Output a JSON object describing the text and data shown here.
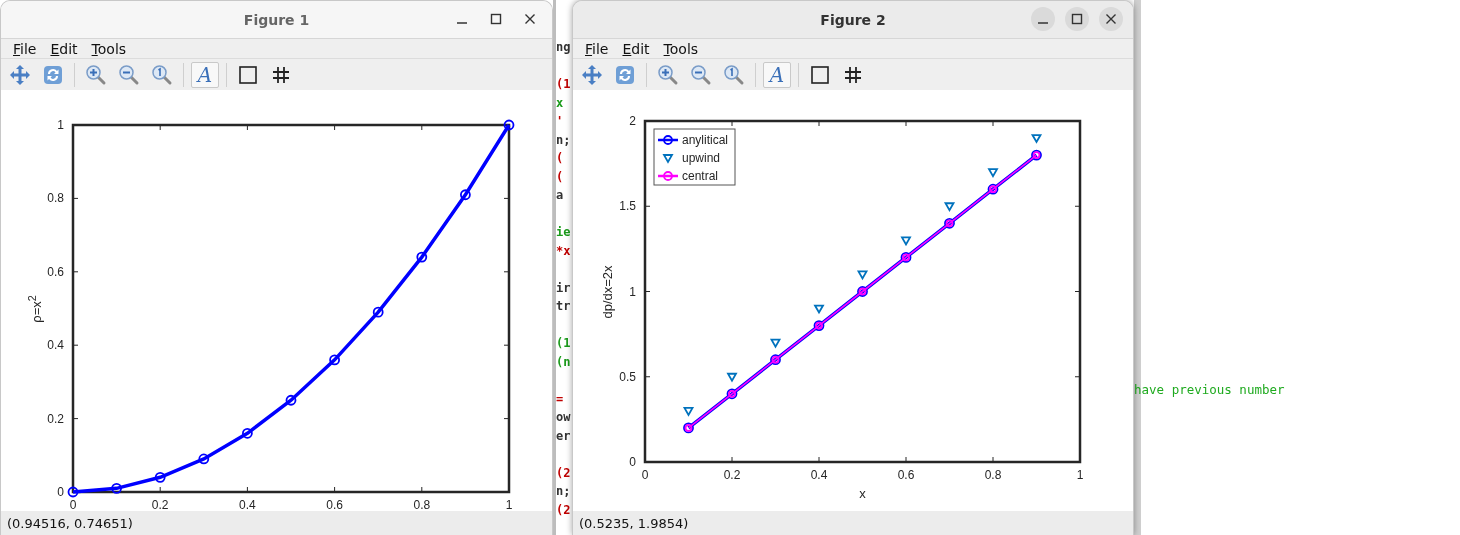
{
  "editor": {
    "strip_lines": [
      {
        "kind": "code",
        "text": "ng",
        "color": "#333333"
      },
      {
        "kind": "blank"
      },
      {
        "kind": "code",
        "text": "(1",
        "color": "#c00000"
      },
      {
        "kind": "code",
        "text": "x",
        "color": "#1a9a1a"
      },
      {
        "kind": "code",
        "text": "'",
        "color": "#c00000"
      },
      {
        "kind": "code",
        "text": "n;",
        "color": "#333333"
      },
      {
        "kind": "code",
        "text": "(",
        "color": "#c00000"
      },
      {
        "kind": "code",
        "text": "(",
        "color": "#c00000"
      },
      {
        "kind": "code",
        "text": "a",
        "color": "#333333"
      },
      {
        "kind": "blank"
      },
      {
        "kind": "code",
        "text": "ie",
        "color": "#1a9a1a"
      },
      {
        "kind": "code",
        "text": "*x",
        "color": "#c00000"
      },
      {
        "kind": "blank"
      },
      {
        "kind": "code",
        "text": "ir",
        "color": "#333333"
      },
      {
        "kind": "code",
        "text": "tr",
        "color": "#333333"
      },
      {
        "kind": "blank"
      },
      {
        "kind": "code",
        "text": "(1",
        "color": "#1a9a1a"
      },
      {
        "kind": "code",
        "text": "(n",
        "color": "#1a9a1a"
      },
      {
        "kind": "blank"
      },
      {
        "kind": "code",
        "text": "=",
        "color": "#c00000"
      },
      {
        "kind": "code",
        "text": "ow",
        "color": "#333333"
      },
      {
        "kind": "code",
        "text": "er",
        "color": "#333333"
      },
      {
        "kind": "blank"
      },
      {
        "kind": "code",
        "text": "(2",
        "color": "#c00000"
      },
      {
        "kind": "code",
        "text": "n;",
        "color": "#333333"
      },
      {
        "kind": "code",
        "text": "(2",
        "color": "#c00000"
      }
    ],
    "comment": "have previous number"
  },
  "figures": [
    {
      "title": "Figure 1",
      "focused": false,
      "menu": [
        {
          "label": "File"
        },
        {
          "label": "Edit"
        },
        {
          "label": "Tools"
        }
      ],
      "tools": [
        {
          "kind": "pan",
          "pressed": false
        },
        {
          "kind": "rotate",
          "pressed": false
        },
        {
          "kind": "separator"
        },
        {
          "kind": "zoom-in",
          "pressed": false
        },
        {
          "kind": "zoom-out",
          "pressed": false
        },
        {
          "kind": "zoom-reset",
          "pressed": false
        },
        {
          "kind": "separator"
        },
        {
          "kind": "text",
          "label": "A",
          "pressed": true
        },
        {
          "kind": "separator"
        },
        {
          "kind": "box",
          "pressed": false
        },
        {
          "kind": "grid",
          "pressed": false
        }
      ],
      "chart_data": {
        "type": "line",
        "ylabel": "ρ=x$^{2}$",
        "x": [
          0,
          0.1,
          0.2,
          0.3,
          0.4,
          0.5,
          0.6,
          0.7,
          0.8,
          0.9,
          1
        ],
        "series": [
          {
            "type": "line",
            "color": "#0000ff",
            "marker": "circle",
            "values": [
              0,
              0.01,
              0.04,
              0.09,
              0.16,
              0.25,
              0.36,
              0.49,
              0.64,
              0.81,
              1
            ]
          }
        ],
        "xlim": [
          0,
          1
        ],
        "ylim": [
          0,
          1
        ],
        "xticks": [
          0,
          0.2,
          0.4,
          0.6,
          0.8,
          1
        ],
        "yticks": [
          0,
          0.2,
          0.4,
          0.6,
          0.8,
          1
        ]
      },
      "status": "(0.94516, 0.74651)"
    },
    {
      "title": "Figure 2",
      "focused": true,
      "menu": [
        {
          "label": "File"
        },
        {
          "label": "Edit"
        },
        {
          "label": "Tools"
        }
      ],
      "tools": [
        {
          "kind": "pan",
          "pressed": false
        },
        {
          "kind": "rotate",
          "pressed": false
        },
        {
          "kind": "separator"
        },
        {
          "kind": "zoom-in",
          "pressed": false
        },
        {
          "kind": "zoom-out",
          "pressed": false
        },
        {
          "kind": "zoom-reset",
          "pressed": false
        },
        {
          "kind": "separator"
        },
        {
          "kind": "text",
          "label": "A",
          "pressed": true
        },
        {
          "kind": "separator"
        },
        {
          "kind": "box",
          "pressed": false
        },
        {
          "kind": "grid",
          "pressed": false
        }
      ],
      "chart_data": {
        "type": "line",
        "xlabel": "x",
        "ylabel": "dp/dx=2x",
        "x": [
          0.1,
          0.2,
          0.3,
          0.4,
          0.5,
          0.6,
          0.7,
          0.8,
          0.9
        ],
        "series": [
          {
            "name": "anylitical",
            "type": "line",
            "color": "#0000ff",
            "marker": "circle",
            "values": [
              0.2,
              0.4,
              0.6,
              0.8,
              1,
              1.2,
              1.4,
              1.6,
              1.8
            ]
          },
          {
            "name": "upwind",
            "type": "scatter",
            "color": "#0072bd",
            "marker": "triangle",
            "values": [
              0.3,
              0.5,
              0.7,
              0.9,
              1.1,
              1.3,
              1.5,
              1.7,
              1.9
            ]
          },
          {
            "name": "central",
            "type": "line",
            "color": "#ff00ff",
            "marker": "circle",
            "values": [
              0.2,
              0.4,
              0.6,
              0.8,
              1,
              1.2,
              1.4,
              1.6,
              1.8
            ]
          }
        ],
        "legend": true,
        "xlim": [
          0,
          1
        ],
        "ylim": [
          0,
          2
        ],
        "xticks": [
          0,
          0.2,
          0.4,
          0.6,
          0.8,
          1
        ],
        "yticks": [
          0,
          0.5,
          1,
          1.5,
          2
        ]
      },
      "status": "(0.5235, 1.9854)"
    }
  ]
}
